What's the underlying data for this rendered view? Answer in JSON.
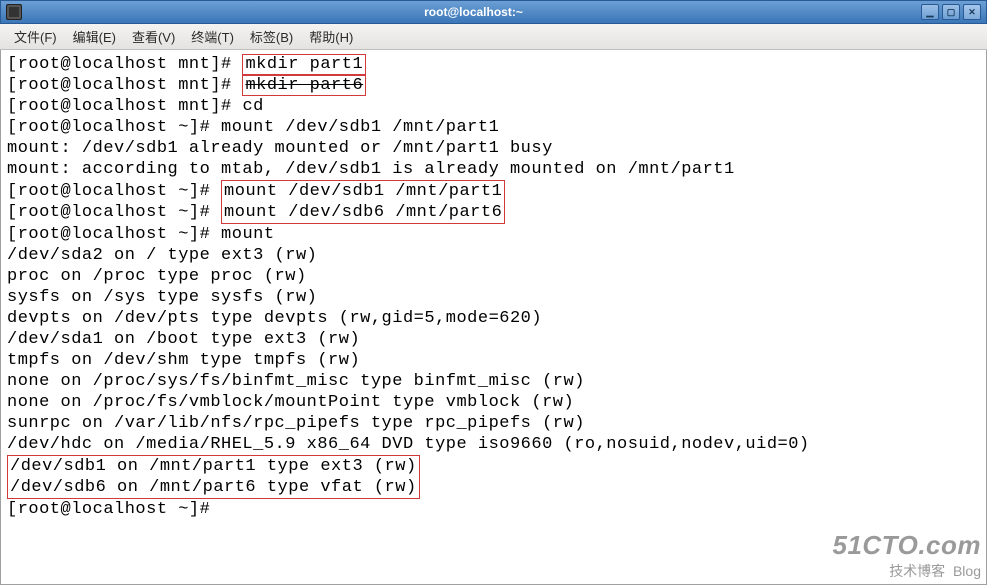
{
  "window": {
    "title": "root@localhost:~"
  },
  "menu": {
    "file": "文件(F)",
    "edit": "编辑(E)",
    "view": "查看(V)",
    "terminal": "终端(T)",
    "tabs": "标签(B)",
    "help": "帮助(H)"
  },
  "prompts": {
    "mnt": "[root@localhost mnt]# ",
    "home": "[root@localhost ~]# "
  },
  "cmds": {
    "mkdir1": "mkdir part1",
    "mkdir6": "mkdir part6",
    "cd": "cd",
    "mount_sdb1": "mount /dev/sdb1 /mnt/part1",
    "mount_sdb1_b": "mount /dev/sdb1 /mnt/part1",
    "mount_sdb6": "mount /dev/sdb6 /mnt/part6",
    "mount": "mount"
  },
  "out": {
    "busy": "mount: /dev/sdb1 already mounted or /mnt/part1 busy",
    "mtab": "mount: according to mtab, /dev/sdb1 is already mounted on /mnt/part1",
    "m0": "/dev/sda2 on / type ext3 (rw)",
    "m1": "proc on /proc type proc (rw)",
    "m2": "sysfs on /sys type sysfs (rw)",
    "m3": "devpts on /dev/pts type devpts (rw,gid=5,mode=620)",
    "m4": "/dev/sda1 on /boot type ext3 (rw)",
    "m5": "tmpfs on /dev/shm type tmpfs (rw)",
    "m6": "none on /proc/sys/fs/binfmt_misc type binfmt_misc (rw)",
    "m7": "none on /proc/fs/vmblock/mountPoint type vmblock (rw)",
    "m8": "sunrpc on /var/lib/nfs/rpc_pipefs type rpc_pipefs (rw)",
    "m9": "/dev/hdc on /media/RHEL_5.9 x86_64 DVD type iso9660 (ro,nosuid,nodev,uid=0)",
    "m10": "/dev/sdb1 on /mnt/part1 type ext3 (rw)",
    "m11": "/dev/sdb6 on /mnt/part6 type vfat (rw)"
  },
  "watermark": {
    "brand": "51CTO.com",
    "sub": "技术博客",
    "tag": "Blog"
  },
  "colors": {
    "highlight_border": "#d13a3a",
    "titlebar_from": "#6b9fd4",
    "titlebar_to": "#3b76b8"
  }
}
